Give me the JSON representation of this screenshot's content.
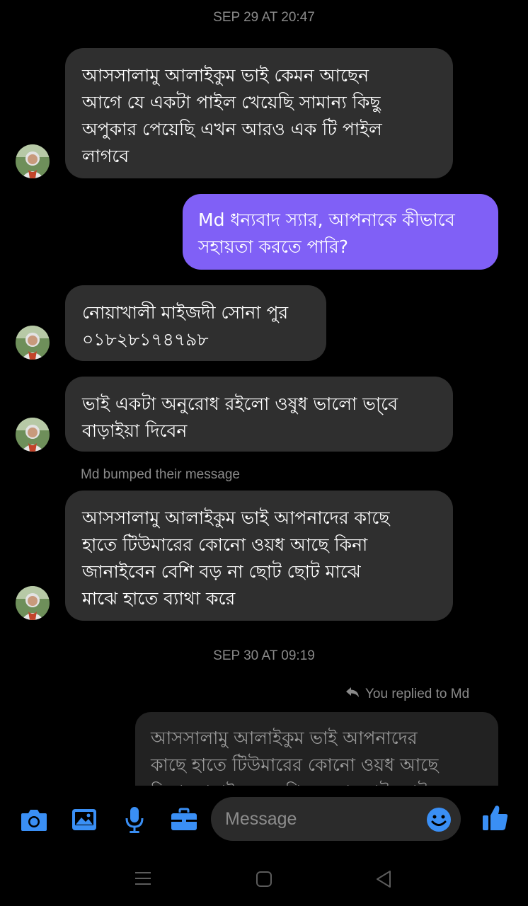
{
  "conversation": {
    "timestamps": [
      "SEP 29 AT 20:47",
      "SEP 30 AT 09:19"
    ],
    "bumped_text": "Md bumped their message",
    "replied_text": "You replied to Md",
    "messages": [
      {
        "text": "আসসালামু আলাইকুম ভাই কেমন আছেন\nআগে যে একটা পাইল খেয়েছি সামান্য কিছু\nঅপুকার পেয়েছি  এখন আরও এক টি পাইল\nলাগবে"
      },
      {
        "text": "Md ধন্যবাদ স্যার, আপনাকে কীভাবে\nসহায়তা করতে পারি?"
      },
      {
        "text": "নোয়াখালী মাইজদী সোনা পুর\n০১৮২৮১৭৪৭৯৮"
      },
      {
        "text": "ভাই  একটা অনুরোধ রইলো ওষুধ ভালো ভা্বে\nবাড়াইয়া দিবেন"
      },
      {
        "text": "আসসালামু আলাইকুম ভাই আপনাদের কাছে\nহাতে টিউমারের  কোনো ওয়ধ আছে কিনা\nজানাইবেন  বেশি বড় না ছোট ছোট মাঝে\nমাঝে হাতে ব্যাথা করে"
      }
    ],
    "quoted_reply": "আসসালামু আলাইকুম ভাই আপনাদের\nকাছে হাতে টিউমারের  কোনো ওয়ধ আছে\nকিনা জানাইবেন  বেশি বড় না ছোট ছোট"
  },
  "composer": {
    "placeholder": "Message",
    "icons": [
      "camera-icon",
      "gallery-icon",
      "microphone-icon",
      "briefcase-icon",
      "emoji-icon",
      "thumbs-up-icon"
    ]
  },
  "navigation": {
    "icons": [
      "menu-icon",
      "home-icon",
      "back-icon"
    ]
  },
  "colors": {
    "background": "#000000",
    "incoming_bubble": "#2f2f2f",
    "outgoing_bubble": "#8060f6",
    "accent": "#3a8ff5",
    "muted_text": "#8a8a8a"
  }
}
